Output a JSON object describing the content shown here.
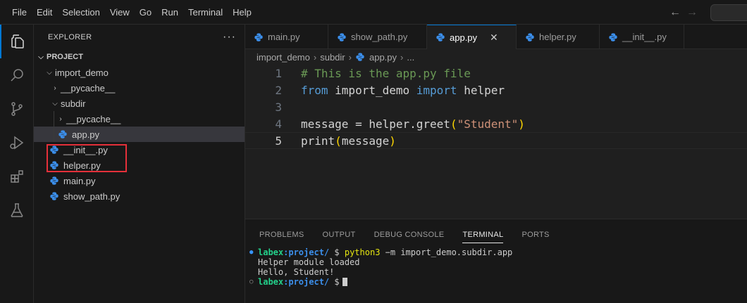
{
  "menu": [
    "File",
    "Edit",
    "Selection",
    "View",
    "Go",
    "Run",
    "Terminal",
    "Help"
  ],
  "sidebar": {
    "title": "EXPLORER",
    "more": "···",
    "project": "PROJECT",
    "tree": [
      {
        "label": "import_demo",
        "type": "folder-open",
        "depth": 1
      },
      {
        "label": "__pycache__",
        "type": "folder-closed",
        "depth": 2
      },
      {
        "label": "subdir",
        "type": "folder-open",
        "depth": 2
      },
      {
        "label": "__pycache__",
        "type": "folder-closed",
        "depth": 3
      },
      {
        "label": "app.py",
        "type": "py",
        "depth": 3,
        "selected": true
      },
      {
        "label": "__init__.py",
        "type": "py",
        "depth": 2
      },
      {
        "label": "helper.py",
        "type": "py",
        "depth": 2
      },
      {
        "label": "main.py",
        "type": "py",
        "depth": 1
      },
      {
        "label": "show_path.py",
        "type": "py",
        "depth": 1
      }
    ]
  },
  "tabs": [
    {
      "label": "main.py",
      "active": false
    },
    {
      "label": "show_path.py",
      "active": false
    },
    {
      "label": "app.py",
      "active": true
    },
    {
      "label": "helper.py",
      "active": false
    },
    {
      "label": "__init__.py",
      "active": false
    }
  ],
  "tab_close": "✕",
  "breadcrumb": [
    "import_demo",
    "subdir",
    "app.py",
    "..."
  ],
  "code": {
    "line_numbers": [
      "1",
      "2",
      "3",
      "4",
      "5"
    ],
    "l1": "# This is the app.py file",
    "l2_kw1": "from",
    "l2_mod": " import_demo ",
    "l2_kw2": "import",
    "l2_name": " helper",
    "l4_a": "message = helper.",
    "l4_fn": "greet",
    "l4_open": "(",
    "l4_str": "\"Student\"",
    "l4_close": ")",
    "l5_fn": "print",
    "l5_open": "(",
    "l5_arg": "message",
    "l5_close": ")"
  },
  "panel": {
    "tabs": [
      "PROBLEMS",
      "OUTPUT",
      "DEBUG CONSOLE",
      "TERMINAL",
      "PORTS"
    ],
    "active_tab": "TERMINAL",
    "terminal": {
      "user": "labex",
      "path1": ":project/",
      "prompt": " $ ",
      "cmd": "python3",
      "args": " −m import_demo.subdir.app",
      "out1": "Helper module loaded",
      "out2": "Hello, Student!",
      "path2": ":project/",
      "prompt2": " $"
    }
  },
  "colors": {
    "accent": "#0078d4",
    "highlight_box": "#e5303a",
    "python_icon": "#3b8eea"
  },
  "icons": [
    "files-icon",
    "search-icon",
    "source-control-icon",
    "run-debug-icon",
    "extensions-icon",
    "testing-icon",
    "back-arrow-icon",
    "forward-arrow-icon",
    "python-file-icon",
    "chevron-right-icon",
    "chevron-down-icon"
  ]
}
